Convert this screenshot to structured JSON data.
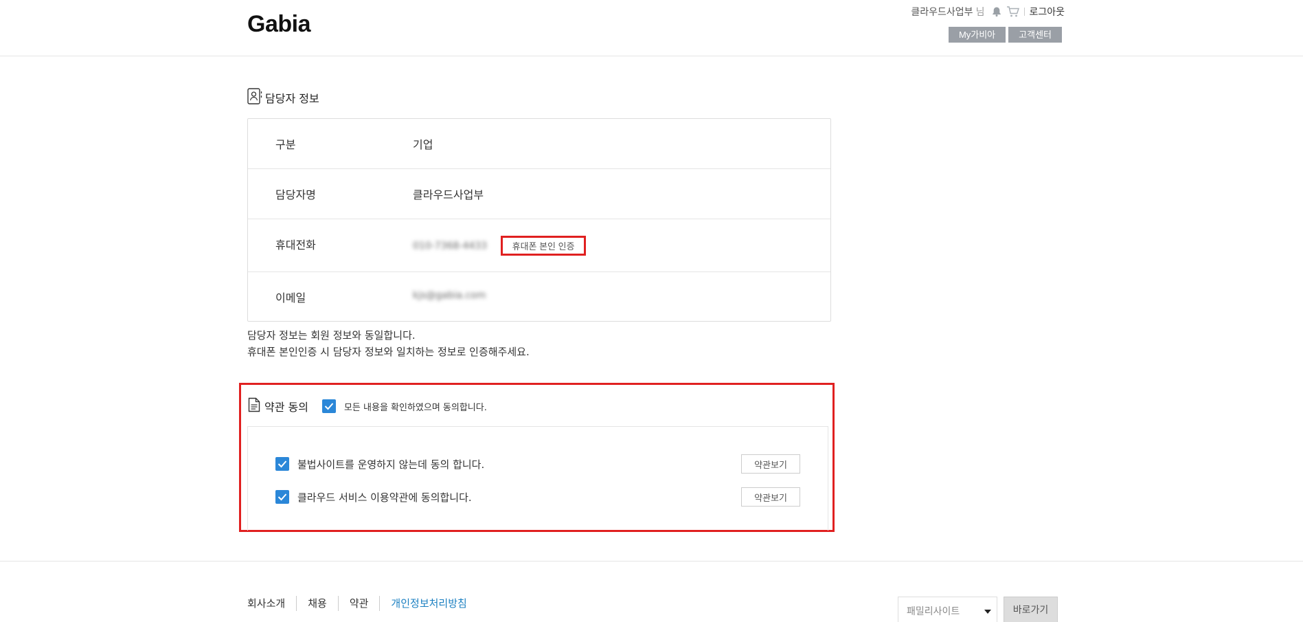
{
  "header": {
    "logo": "Gabia",
    "user_name": "클라우드사업부",
    "user_suffix": "님",
    "logout": "로그아웃",
    "buttons": {
      "my_gabia": "My가비아",
      "support": "고객센터"
    }
  },
  "contact_section": {
    "title": "담당자 정보",
    "rows": [
      {
        "label": "구분",
        "value": "기업"
      },
      {
        "label": "담당자명",
        "value": "클라우드사업부"
      },
      {
        "label": "휴대전화",
        "value": "010-7368-4433",
        "verify_button": "휴대폰 본인 인증"
      },
      {
        "label": "이메일",
        "value": "kjs@gabia.com"
      }
    ],
    "notice_lines": [
      "담당자 정보는 회원 정보와 동일합니다.",
      "휴대폰 본인인증 시 담당자 정보와 일치하는 정보로 인증해주세요."
    ]
  },
  "terms_section": {
    "title": "약관 동의",
    "agree_all": "모든 내용을 확인하였으며 동의합니다.",
    "items": [
      {
        "label": "불법사이트를 운영하지 않는데 동의 합니다.",
        "button": "약관보기",
        "checked": true
      },
      {
        "label": "클라우드 서비스 이용약관에 동의합니다.",
        "button": "약관보기",
        "checked": true
      }
    ]
  },
  "footer": {
    "links": [
      "회사소개",
      "채용",
      "약관",
      "개인정보처리방침"
    ],
    "family_select": "패밀리사이트",
    "go_button": "바로가기"
  },
  "colors": {
    "accent": "#2b87d8",
    "highlight": "#e02020",
    "link_blue": "#1a7fc1",
    "button_gray": "#9a9fa6"
  },
  "icons": [
    "bell-icon",
    "cart-icon",
    "contact-card-icon",
    "document-icon",
    "checkbox-checked-icon",
    "dropdown-caret-icon"
  ]
}
